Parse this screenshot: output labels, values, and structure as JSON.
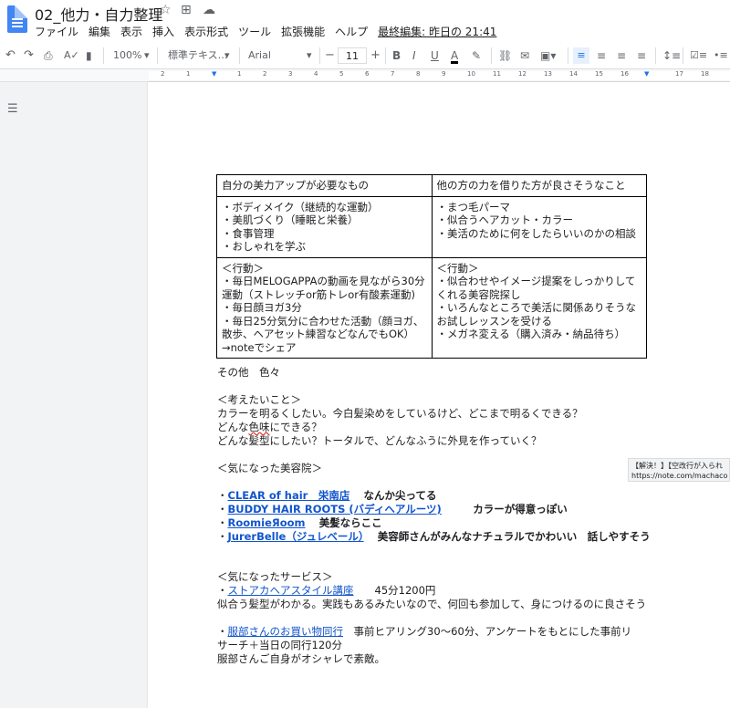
{
  "document": {
    "title": "02_他力・自力整理"
  },
  "menus": [
    "ファイル",
    "編集",
    "表示",
    "挿入",
    "表示形式",
    "ツール",
    "拡張機能",
    "ヘルプ"
  ],
  "last_edit": "最終編集: 昨日の 21:41",
  "toolbar": {
    "zoom": "100%",
    "style": "標準テキス…",
    "font": "Arial",
    "size": "11"
  },
  "ruler_numbers": [
    "2",
    "1",
    "1",
    "2",
    "3",
    "4",
    "5",
    "6",
    "7",
    "8",
    "9",
    "10",
    "11",
    "12",
    "13",
    "14",
    "15",
    "16",
    "17",
    "18"
  ],
  "table": {
    "h1": "自分の美力アップが必要なもの",
    "h2": "他の方の力を借りた方が良さそうなこと",
    "r1c1": [
      "・ボディメイク（継続的な運動）",
      "・美肌づくり（睡眠と栄養）",
      "・食事管理",
      "・おしゃれを学ぶ"
    ],
    "r1c2": [
      "・まつ毛パーマ",
      "・似合うヘアカット・カラー",
      "・美活のために何をしたらいいのかの相談"
    ],
    "r2c1": [
      "＜行動＞",
      "・毎日MELOGAPPAの動画を見ながら30分",
      "運動（ストレッチor筋トレor有酸素運動)",
      "・毎日顔ヨガ3分",
      "・毎日25分気分に合わせた活動（顔ヨガ、",
      "散歩、ヘアセット練習などなんでもOK）",
      "→noteでシェア"
    ],
    "r2c2": [
      "＜行動＞",
      "・似合わせやイメージ提案をしっかりして",
      "くれる美容院探し",
      "・いろんなところで美活に関係ありそうな",
      "お試しレッスンを受ける",
      "・メガネ変える（購入済み・納品待ち）"
    ]
  },
  "body": {
    "other": "その他　色々",
    "think_head": "＜考えたいこと＞",
    "think1": "カラーを明るくしたい。今白髪染めをしているけど、どこまで明るくできる？",
    "think2a": "どんな",
    "think2b": "色味",
    "think2c": "にできる？",
    "think3": "どんな髪型にしたい？トータルで、どんなふうに外見を作っていく？",
    "salon_head": "＜気になった美容院＞",
    "salon1_link": "CLEAR of hair　栄南店",
    "salon1_note": "なんか尖ってる",
    "salon2_link": "BUDDY HAIR ROOTS (バディヘアルーツ)",
    "salon2_note": "カラーが得意っぽい",
    "salon3_link": "RoomieЯoom",
    "salon3_note": "美髪ならここ",
    "salon4_link": "JurerBelle（ジュレベール）",
    "salon4_note": "美容師さんがみんなナチュラルでかわいい　話しやすそう",
    "service_head": "＜気になったサービス＞",
    "service1_link": "ストアカヘアスタイル講座",
    "service1_note": "45分1200円",
    "service1_desc": "似合う髪型がわかる。実践もあるみたいなので、何回も参加して、身につけるのに良さそう",
    "service2_link": "服部さんのお買い物同行",
    "service2_note": "事前ヒアリング30〜60分、アンケートをもとにした事前リ",
    "service2_desc1": "サーチ＋当日の同行120分",
    "service2_desc2": "服部さんご自身がオシャレで素敵。"
  },
  "tooltip": {
    "line1": "【解決！】【空改行が入られ",
    "line2": "https://note.com/machaco"
  }
}
